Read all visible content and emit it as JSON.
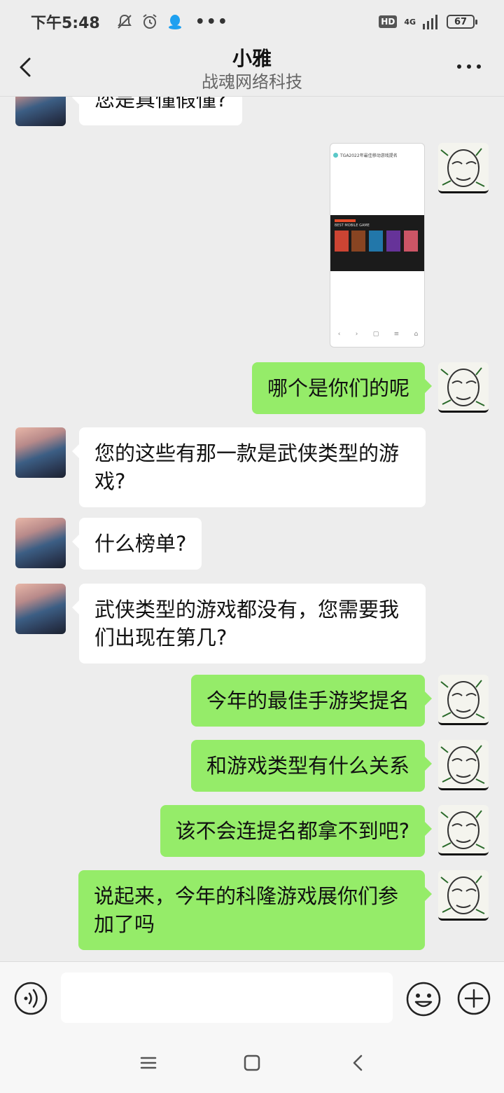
{
  "status_bar": {
    "time": "下午5:48",
    "hd": "HD",
    "network": "4G",
    "battery": "67"
  },
  "header": {
    "title": "小雅",
    "subtitle": "战魂网络科技",
    "back_icon": "chevron-left-icon",
    "more_icon": "more-horizontal-icon"
  },
  "messages": [
    {
      "side": "in",
      "type": "text",
      "text": "您是真懂假懂?"
    },
    {
      "side": "out",
      "type": "image",
      "image_text": "TGA2022年最佳移动游戏提名",
      "banner_text": "BEST MOBILE GAME"
    },
    {
      "side": "out",
      "type": "text",
      "text": "哪个是你们的呢"
    },
    {
      "side": "in",
      "type": "text",
      "text": "您的这些有那一款是武侠类型的游戏?"
    },
    {
      "side": "in",
      "type": "text",
      "text": "什么榜单?"
    },
    {
      "side": "in",
      "type": "text",
      "text": "武侠类型的游戏都没有，您需要我们出现在第几?"
    },
    {
      "side": "out",
      "type": "text",
      "text": "今年的最佳手游奖提名"
    },
    {
      "side": "out",
      "type": "text",
      "text": "和游戏类型有什么关系"
    },
    {
      "side": "out",
      "type": "text",
      "text": "该不会连提名都拿不到吧?"
    },
    {
      "side": "out",
      "type": "text",
      "text": "说起来，今年的科隆游戏展你们参加了吗"
    }
  ],
  "input_bar": {
    "value": "",
    "voice_icon": "voice-icon",
    "emoji_icon": "emoji-icon",
    "plus_icon": "plus-circle-icon"
  },
  "colors": {
    "chat_bg": "#ededed",
    "bubble_out": "#95ec69",
    "bubble_in": "#ffffff"
  }
}
